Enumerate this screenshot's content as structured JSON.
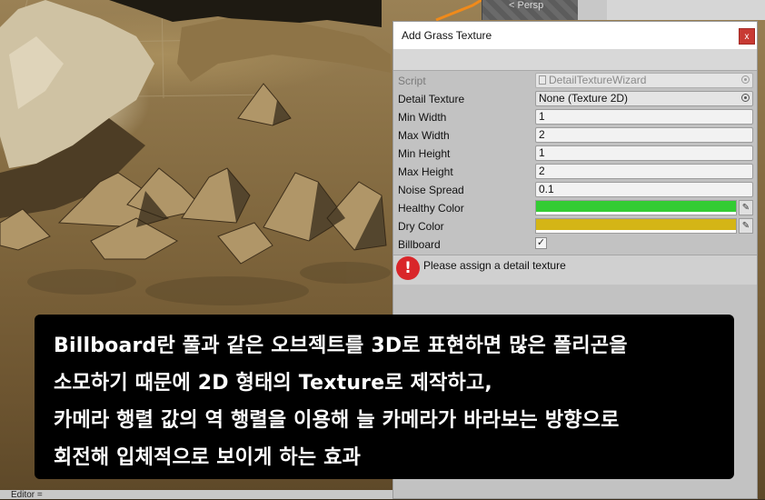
{
  "scene": {
    "persp_label": "< Persp"
  },
  "wizard": {
    "title": "Add Grass Texture",
    "close_label": "x",
    "rows": [
      {
        "label": "Script",
        "value": "DetailTextureWizard",
        "type": "object",
        "disabled": true
      },
      {
        "label": "Detail Texture",
        "value": "None (Texture 2D)",
        "type": "object"
      },
      {
        "label": "Min Width",
        "value": "1",
        "type": "text"
      },
      {
        "label": "Max Width",
        "value": "2",
        "type": "text"
      },
      {
        "label": "Min Height",
        "value": "1",
        "type": "text"
      },
      {
        "label": "Max Height",
        "value": "2",
        "type": "text"
      },
      {
        "label": "Noise Spread",
        "value": "0.1",
        "type": "text"
      },
      {
        "label": "Healthy Color",
        "color": "#33cc33",
        "type": "color"
      },
      {
        "label": "Dry Color",
        "color": "#d4b516",
        "type": "color"
      },
      {
        "label": "Billboard",
        "checked": true,
        "type": "checkbox"
      }
    ],
    "help": {
      "icon": "error-icon",
      "icon_glyph": "!",
      "text": "Please assign a detail texture"
    }
  },
  "subtitle": {
    "lines": [
      "Billboard란 풀과 같은 오브젝트를 3D로 표현하면 많은 폴리곤을",
      "소모하기 때문에 2D 형태의 Texture로 제작하고,",
      "카메라 행렬 값의 역 행렬을 이용해 늘 카메라가 바라보는 방향으로",
      "회전해 입체적으로 보이게 하는 효과"
    ]
  },
  "bottom": {
    "editor_tab": "Editor ="
  },
  "icons": {
    "close": "close-icon",
    "object_picker": "object-picker-icon",
    "eyedropper": "eyedropper-icon",
    "check": "checkmark-icon",
    "script": "script-file-icon"
  }
}
